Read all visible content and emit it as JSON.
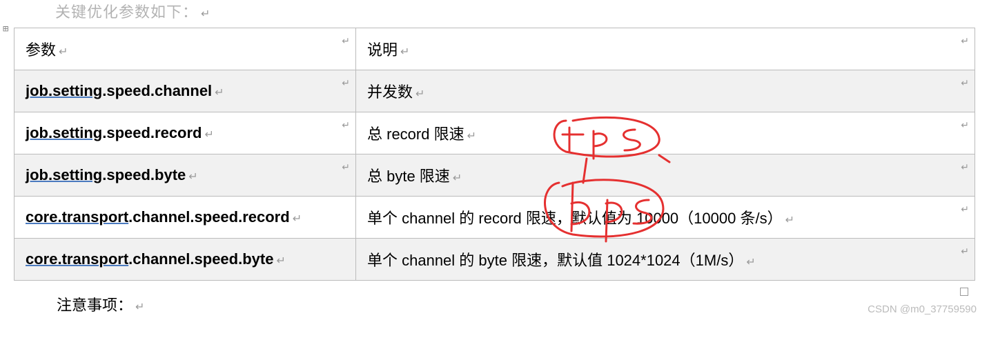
{
  "intro_text": "关键优化参数如下：",
  "table": {
    "header": {
      "param": "参数",
      "desc": "说明"
    },
    "rows": [
      {
        "param_ul": "job.setting",
        "param_rest": ".speed.channel",
        "desc": "并发数"
      },
      {
        "param_ul": "job.setting",
        "param_rest": ".speed.record",
        "desc": "总 record 限速"
      },
      {
        "param_ul": "job.setting",
        "param_rest": ".speed.byte",
        "desc": "总 byte 限速"
      },
      {
        "param_ul": "core.transport",
        "param_rest": ".channel.speed.record",
        "desc": "单个 channel 的 record 限速，默认值为 10000（10000 条/s）"
      },
      {
        "param_ul": "core.transport",
        "param_rest": ".channel.speed.byte",
        "desc": "单个 channel 的 byte 限速，默认值 1024*1024（1M/s）"
      }
    ]
  },
  "annotations": {
    "note1": "tps",
    "note2": "bps"
  },
  "notes_heading": "注意事项：",
  "paragraph_mark": "↵",
  "toggle_icon": "⊞",
  "watermark": "CSDN @m0_37759590"
}
